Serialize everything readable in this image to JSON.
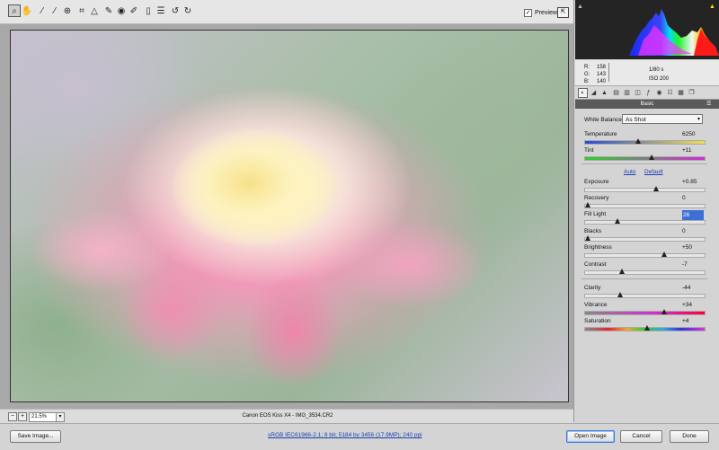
{
  "toolbar": {
    "tools": [
      "zoom-tool-icon",
      "hand-tool-icon",
      "white-balance-tool-icon",
      "color-sampler-tool-icon",
      "target-adjustment-tool-icon",
      "crop-tool-icon",
      "straighten-tool-icon",
      "spot-removal-tool-icon",
      "red-eye-removal-tool-icon",
      "adjustment-brush-icon",
      "graduated-filter-icon",
      "preferences-icon",
      "rotate-left-icon",
      "rotate-right-icon"
    ],
    "preview_label": "Preview",
    "preview_checked": "✓"
  },
  "image": {
    "caption": "Canon EOS Kiss X4  -  IMG_3534.CR2",
    "zoom": "21.5%"
  },
  "readout": {
    "r_label": "R:",
    "r_value": "158",
    "g_label": "G:",
    "g_value": "143",
    "b_label": "B:",
    "b_value": "140",
    "shutter": "1/80 s",
    "iso": "ISO 200"
  },
  "panel": {
    "title": "Basic",
    "white_balance_label": "White Balance:",
    "white_balance_value": "As Shot",
    "auto_label": "Auto",
    "default_label": "Default",
    "sliders": [
      {
        "name": "Temperature",
        "value": "6250",
        "pos": 0.44
      },
      {
        "name": "Tint",
        "value": "+11",
        "pos": 0.56
      },
      {
        "name": "Exposure",
        "value": "+0.85",
        "pos": 0.6
      },
      {
        "name": "Recovery",
        "value": "0",
        "pos": 0.0
      },
      {
        "name": "Fill Light",
        "value": "26",
        "pos": 0.26
      },
      {
        "name": "Blacks",
        "value": "0",
        "pos": 0.0
      },
      {
        "name": "Brightness",
        "value": "+50",
        "pos": 0.67
      },
      {
        "name": "Contrast",
        "value": "-7",
        "pos": 0.3
      },
      {
        "name": "Clarity",
        "value": "-44",
        "pos": 0.28
      },
      {
        "name": "Vibrance",
        "value": "+34",
        "pos": 0.67
      },
      {
        "name": "Saturation",
        "value": "+4",
        "pos": 0.52
      }
    ]
  },
  "footer": {
    "save_label": "Save Image...",
    "workflow_label": "sRGB IEC61966-2.1; 8 bit; 5184 by 3456 (17.9MP); 240 ppi",
    "open_label": "Open Image",
    "cancel_label": "Cancel",
    "done_label": "Done"
  }
}
